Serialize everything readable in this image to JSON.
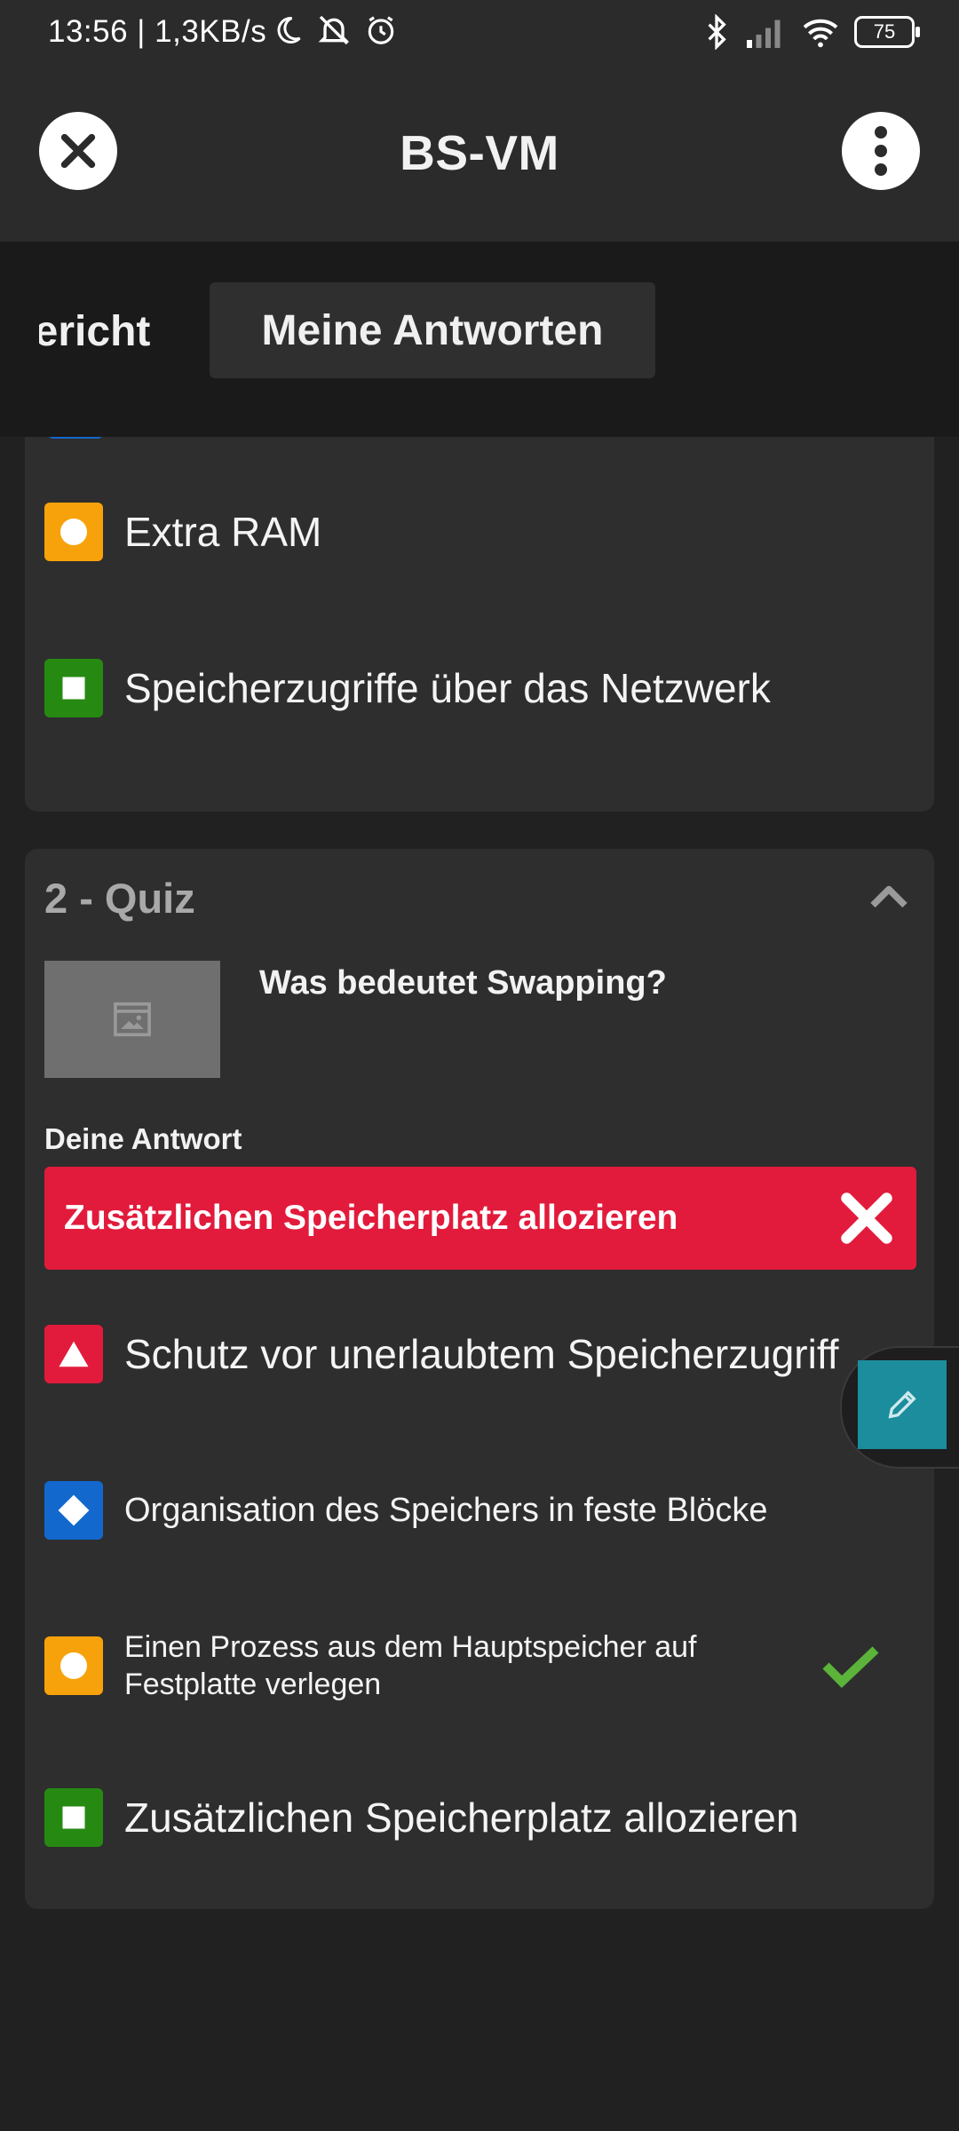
{
  "status_bar": {
    "time": "13:56 | 1,3KB/s",
    "battery": "75",
    "icons": [
      "moon-icon",
      "silent-bell-icon",
      "alarm-icon",
      "bluetooth-icon",
      "signal-icon",
      "wifi-icon",
      "battery-icon"
    ]
  },
  "app_bar": {
    "title": "BS-VM",
    "close_icon": "close-icon",
    "menu_icon": "more-vertical-icon"
  },
  "tabs": {
    "partial_label": "Bericht",
    "active_label": "Meine Antworten"
  },
  "previous_question": {
    "options": [
      {
        "label": "Extra RAM",
        "shape": "circle",
        "color": "#f7a20a"
      },
      {
        "label": "Speicherzugriffe über das Netzwerk",
        "shape": "square",
        "color": "#268a12"
      }
    ]
  },
  "quiz": {
    "title": "2 - Quiz",
    "question": "Was bedeutet Swapping?",
    "image_icon": "image-placeholder-icon",
    "your_answer_label": "Deine Antwort",
    "your_answer": "Zusätzlichen Speicherplatz allozieren",
    "answer_status": "incorrect",
    "answer_color": "#e21b3c",
    "options": [
      {
        "label": "Schutz vor unerlaubtem Speicherzugriff",
        "shape": "triangle",
        "color": "#e21b3c",
        "correct": false
      },
      {
        "label": "Organisation des Speichers in feste Blöcke",
        "shape": "diamond",
        "color": "#1368ce",
        "correct": false
      },
      {
        "label": "Einen Prozess aus dem Hauptspeicher auf Festplatte verlegen",
        "shape": "circle",
        "color": "#f7a20a",
        "correct": true
      },
      {
        "label": "Zusätzlichen Speicherplatz allozieren",
        "shape": "square",
        "color": "#268a12",
        "correct": false
      }
    ],
    "correct_color": "#5bb33a"
  },
  "fab": {
    "icon": "pencil-icon",
    "color": "#1b8d9c"
  }
}
